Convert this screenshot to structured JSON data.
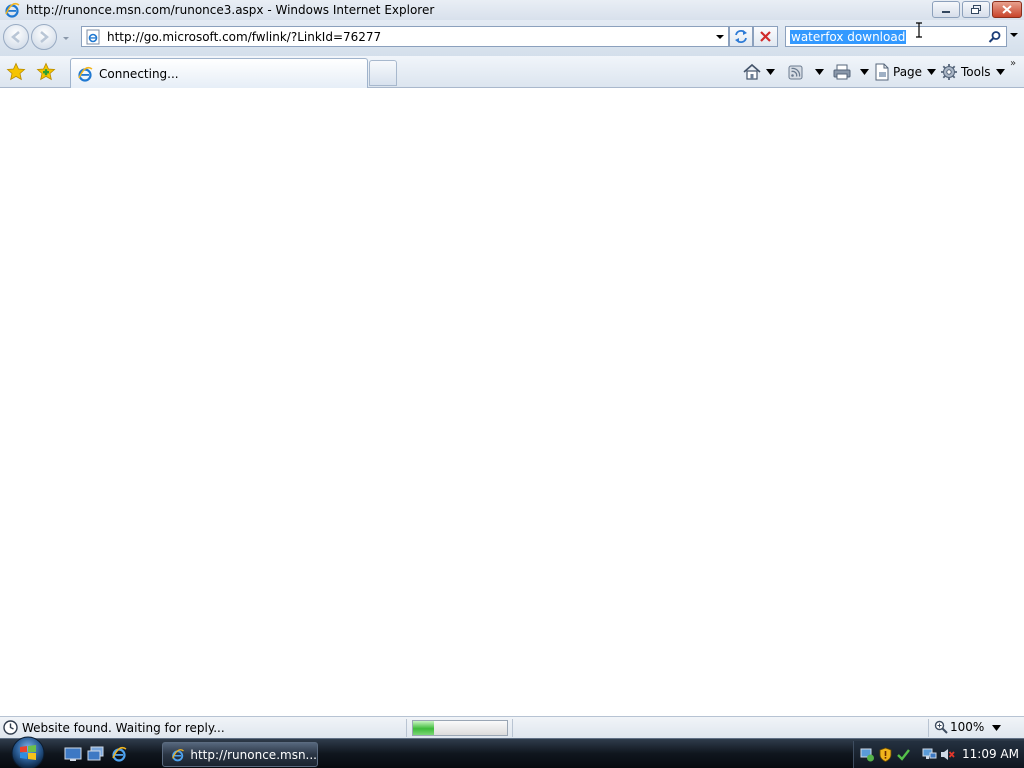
{
  "window": {
    "title": "http://runonce.msn.com/runonce3.aspx - Windows Internet Explorer"
  },
  "address_bar": {
    "url": "http://go.microsoft.com/fwlink/?LinkId=76277"
  },
  "search_box": {
    "value": "waterfox download"
  },
  "tab": {
    "title": "Connecting..."
  },
  "command_bar": {
    "page_label": "Page",
    "tools_label": "Tools"
  },
  "status_bar": {
    "text": "Website found. Waiting for reply...",
    "progress_percent": 22,
    "zoom": "100%"
  },
  "taskbar": {
    "task_label": "http://runonce.msn...",
    "clock": "11:09 AM"
  },
  "colors": {
    "selection": "#3399ff",
    "progress": "#3dbb3a",
    "close_button": "#c8442b"
  }
}
